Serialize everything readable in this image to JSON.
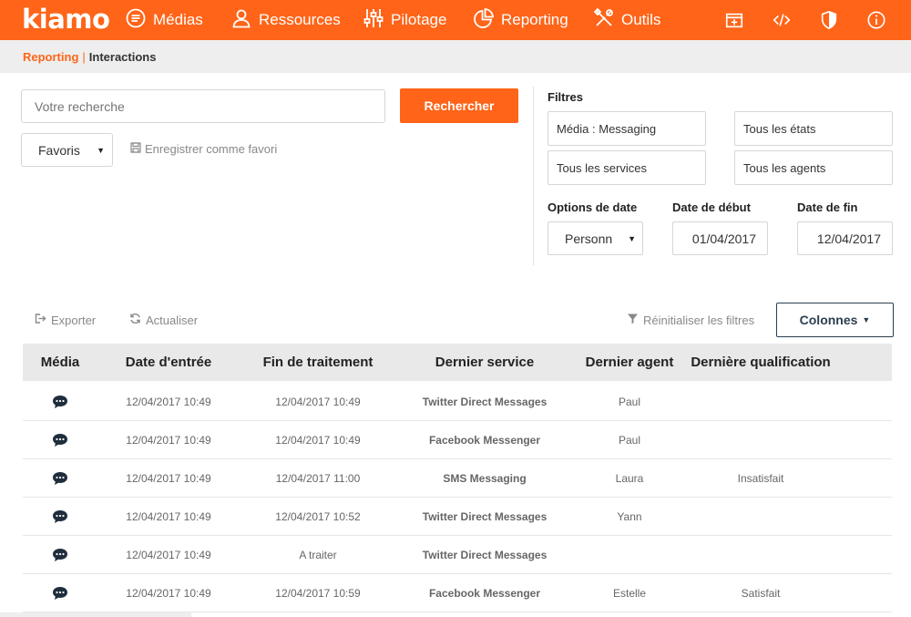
{
  "app": {
    "logo": "kiamo"
  },
  "nav": {
    "items": [
      {
        "label": "Médias",
        "icon": "chat-bubble-icon"
      },
      {
        "label": "Ressources",
        "icon": "user-icon"
      },
      {
        "label": "Pilotage",
        "icon": "sliders-icon"
      },
      {
        "label": "Reporting",
        "icon": "pie-chart-icon"
      },
      {
        "label": "Outils",
        "icon": "tools-icon"
      }
    ],
    "right_icons": [
      "calendar-icon",
      "code-icon",
      "shield-icon",
      "info-icon"
    ]
  },
  "breadcrumb": {
    "parent": "Reporting",
    "separator": "|",
    "current": "Interactions"
  },
  "search": {
    "placeholder": "Votre recherche",
    "button_label": "Rechercher",
    "favorites_label": "Favoris",
    "save_favorite_label": "Enregistrer comme favori"
  },
  "filters": {
    "title": "Filtres",
    "media": "Média : Messaging",
    "states": "Tous les états",
    "services": "Tous les services",
    "agents": "Tous les agents",
    "date_options_label": "Options de date",
    "date_options_value": "Personn",
    "start_date_label": "Date de début",
    "start_date_value": "01/04/2017",
    "end_date_label": "Date de fin",
    "end_date_value": "12/04/2017"
  },
  "toolbar": {
    "export_label": "Exporter",
    "refresh_label": "Actualiser",
    "reset_filters_label": "Réinitialiser les filtres",
    "columns_label": "Colonnes"
  },
  "table": {
    "headers": [
      "Média",
      "Date d'entrée",
      "Fin de traitement",
      "Dernier service",
      "Dernier agent",
      "Dernière qualification"
    ],
    "rows": [
      {
        "media_icon": "chat-bubble-icon",
        "entry": "12/04/2017 10:49",
        "end": "12/04/2017 10:49",
        "service": "Twitter Direct Messages",
        "agent": "Paul",
        "qualification": ""
      },
      {
        "media_icon": "chat-bubble-icon",
        "entry": "12/04/2017 10:49",
        "end": "12/04/2017 10:49",
        "service": "Facebook Messenger",
        "agent": "Paul",
        "qualification": ""
      },
      {
        "media_icon": "chat-bubble-icon",
        "entry": "12/04/2017 10:49",
        "end": "12/04/2017 11:00",
        "service": "SMS Messaging",
        "agent": "Laura",
        "qualification": "Insatisfait"
      },
      {
        "media_icon": "chat-bubble-icon",
        "entry": "12/04/2017 10:49",
        "end": "12/04/2017 10:52",
        "service": "Twitter Direct Messages",
        "agent": "Yann",
        "qualification": ""
      },
      {
        "media_icon": "chat-bubble-icon",
        "entry": "12/04/2017 10:49",
        "end": "A traiter",
        "service": "Twitter Direct Messages",
        "agent": "",
        "qualification": ""
      },
      {
        "media_icon": "chat-bubble-icon",
        "entry": "12/04/2017 10:49",
        "end": "12/04/2017 10:59",
        "service": "Facebook Messenger",
        "agent": "Estelle",
        "qualification": "Satisfait"
      }
    ]
  },
  "colors": {
    "accent": "#ff6418",
    "dark": "#2c3e50"
  }
}
